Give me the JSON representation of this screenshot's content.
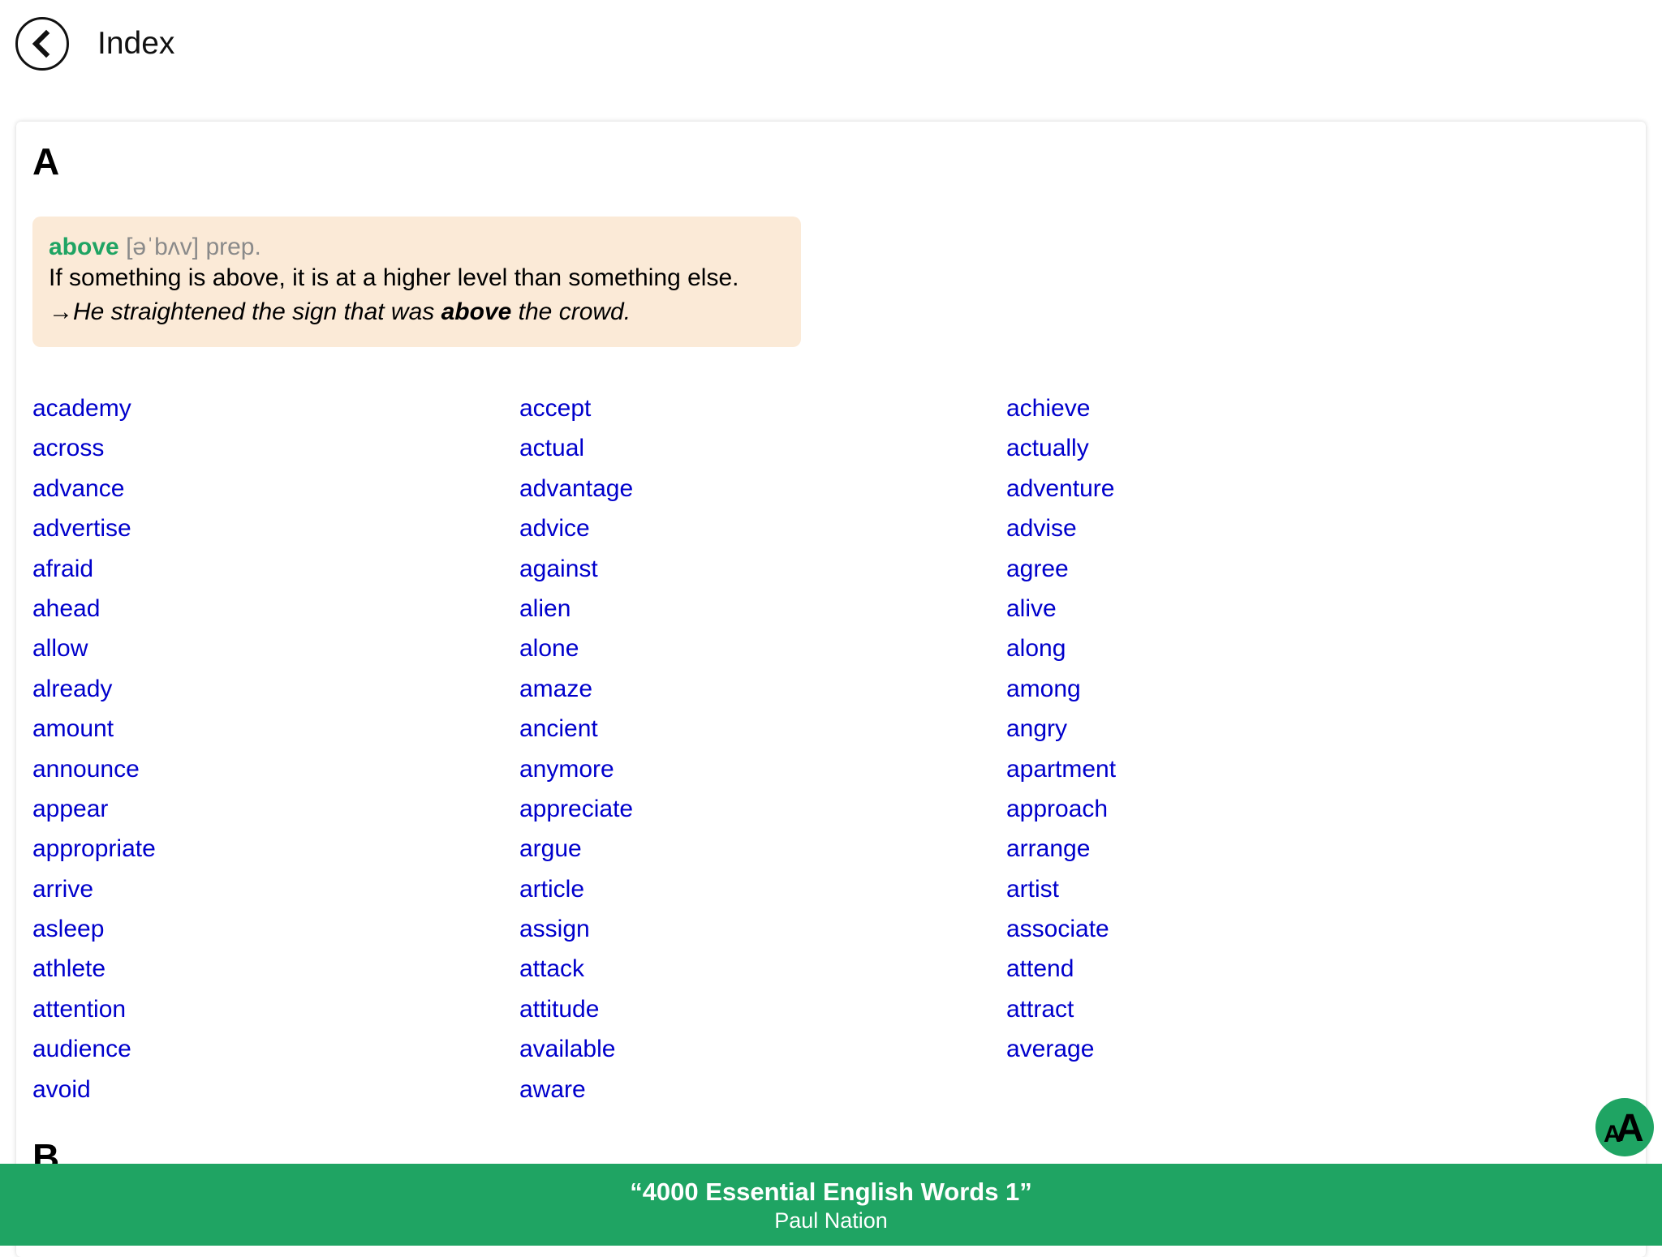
{
  "header": {
    "back_icon": "chevron-left-circle-icon",
    "title": "Index"
  },
  "section": {
    "letter": "A",
    "next_letter": "B",
    "featured": {
      "word": "above",
      "phonetic": "[əˈbʌv]",
      "pos": "prep.",
      "definition": "If something is above, it is at a higher level than something else.",
      "example_arrow": "→",
      "example_before": "He straightened the sign that was ",
      "example_bold": "above",
      "example_after": " the crowd."
    },
    "columns": [
      [
        "academy",
        "across",
        "advance",
        "advertise",
        "afraid",
        "ahead",
        "allow",
        "already",
        "amount",
        "announce",
        "appear",
        "appropriate",
        "arrive",
        "asleep",
        "athlete",
        "attention",
        "audience",
        "avoid"
      ],
      [
        "accept",
        "actual",
        "advantage",
        "advice",
        "against",
        "alien",
        "alone",
        "amaze",
        "ancient",
        "anymore",
        "appreciate",
        "argue",
        "article",
        "assign",
        "attack",
        "attitude",
        "available",
        "aware"
      ],
      [
        "achieve",
        "actually",
        "adventure",
        "advise",
        "agree",
        "alive",
        "along",
        "among",
        "angry",
        "apartment",
        "approach",
        "arrange",
        "artist",
        "associate",
        "attend",
        "attract",
        "average"
      ]
    ]
  },
  "fab": {
    "icon": "font-size-icon",
    "small_glyph": "A",
    "big_glyph": "A"
  },
  "footer": {
    "book_title": "“4000 Essential English Words 1”",
    "author": "Paul Nation"
  },
  "colors": {
    "accent_green": "#1fa463",
    "link_blue": "#0000cc",
    "definition_bg": "#fbead7"
  }
}
